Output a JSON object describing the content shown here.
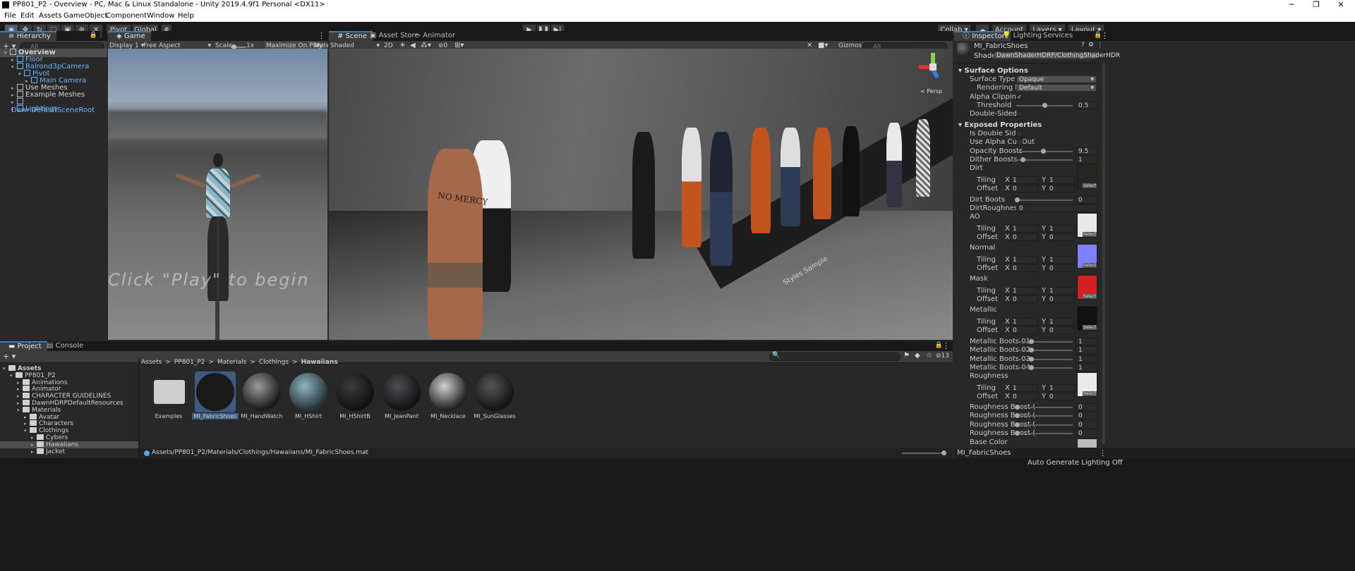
{
  "window": {
    "title": "PP801_P2 - Overview - PC, Mac & Linux Standalone - Unity 2019.4.9f1 Personal <DX11>",
    "controls": [
      "─",
      "❐",
      "✕"
    ]
  },
  "menu": [
    "File",
    "Edit",
    "Assets",
    "GameObject",
    "Component",
    "Window",
    "Help"
  ],
  "toolbar": {
    "pivot": "Pivot",
    "global": "Global",
    "collab": "Collab ▾",
    "account": "Account",
    "layers": "Layers",
    "layout": "Layout"
  },
  "hierarchy": {
    "tab": "Hierarchy",
    "search_placeholder": "All",
    "items": [
      {
        "label": "Overview",
        "indent": 0,
        "selected": true,
        "blue": false
      },
      {
        "label": "Floor",
        "indent": 1,
        "blue": true
      },
      {
        "label": "Balrond3pCamera",
        "indent": 1,
        "blue": true
      },
      {
        "label": "Pivot",
        "indent": 2,
        "blue": true
      },
      {
        "label": "Main Camera",
        "indent": 3,
        "blue": true
      },
      {
        "label": "Use Meshes",
        "indent": 1,
        "blue": false
      },
      {
        "label": "Example Meshes",
        "indent": 1,
        "blue": false
      },
      {
        "label": "DawnDefaultSceneRoot",
        "indent": 1,
        "blue": true
      },
      {
        "label": "Lightings",
        "indent": 1,
        "blue": true
      }
    ]
  },
  "game": {
    "tab": "Game",
    "display": "Display 1",
    "aspect": "Free Aspect",
    "scale_label": "Scale",
    "scale_value": "1x",
    "maximize": "Maximize On Play",
    "mute": "Mute",
    "overlay_text": "Click \"Play\" to begin"
  },
  "scene": {
    "tabs": [
      "Scene",
      "Asset Store",
      "Animator"
    ],
    "shading": "Shaded",
    "mode2d": "2D",
    "gizmos": "Gizmos",
    "search_placeholder": "All",
    "hidden_count": "0",
    "persp": "< Persp",
    "chest_text": "NO MERCY",
    "floor_text": "Styles Sample"
  },
  "inspector": {
    "tabs": [
      "Inspector",
      "Lighting",
      "Services"
    ],
    "material_name": "MI_FabricShoes",
    "shader_label": "Shader",
    "shader_value": "DawnShaderHDRP/ClothingShaderHDR",
    "surface_options": "Surface Options",
    "surface_type_label": "Surface Type",
    "surface_type": "Opaque",
    "rendering_pass_label": "Rendering Pass",
    "rendering_pass": "Default",
    "alpha_clipping": "Alpha Clipping",
    "threshold_label": "Threshold",
    "threshold": "0.5",
    "double_sided": "Double-Sided",
    "exposed": "Exposed Properties",
    "is_double_side": "Is Double Side",
    "use_alpha_cut": "Use Alpha Cut Out",
    "opacity_label": "Opacity Boosts",
    "opacity": "9.5",
    "dither_label": "Dither Boosts",
    "dither": "1",
    "tex_sections": [
      {
        "name": "Dirt",
        "color": "#2a2520"
      },
      {
        "name": "AO",
        "color": "#e9e9e9"
      },
      {
        "name": "Normal",
        "color": "#7f7fff"
      },
      {
        "name": "Mask",
        "color": "#d42020"
      },
      {
        "name": "Metallic",
        "color": "#111111"
      }
    ],
    "tiling": "Tiling",
    "offset": "Offset",
    "x": "X",
    "y": "Y",
    "one": "1",
    "zero": "0",
    "select": "Select",
    "dirt_boots_label": "Dirt Boots",
    "dirt_boots": "0",
    "dirt_roughness_label": "DirtRoughness_Po",
    "dirt_roughness": "0",
    "metallic_boosts": [
      {
        "label": "Metallic Boots 01",
        "value": "1"
      },
      {
        "label": "Metallic Boots 02",
        "value": "1"
      },
      {
        "label": "Metallic Boots 03",
        "value": "1"
      },
      {
        "label": "Metallic Boots 04",
        "value": "1"
      }
    ],
    "roughness_label": "Roughness",
    "roughness_boosts": [
      {
        "label": "Roughness Boost (",
        "value": "0"
      },
      {
        "label": "Roughness Boost (",
        "value": "0"
      },
      {
        "label": "Roughness Boost (",
        "value": "0"
      },
      {
        "label": "Roughness Boost (",
        "value": "0"
      }
    ],
    "base_color": "Base Color",
    "footer_name": "MI_FabricShoes"
  },
  "project": {
    "tabs": [
      "Project",
      "Console"
    ],
    "tree": [
      {
        "label": "Assets",
        "indent": 0,
        "bold": true
      },
      {
        "label": "PP801_P2",
        "indent": 1
      },
      {
        "label": "Animations",
        "indent": 2
      },
      {
        "label": "Animator",
        "indent": 2
      },
      {
        "label": "CHARACTER GUIDELINES",
        "indent": 2
      },
      {
        "label": "DawnHDRPDefaultResources",
        "indent": 2
      },
      {
        "label": "Materials",
        "indent": 2
      },
      {
        "label": "Avatar",
        "indent": 3
      },
      {
        "label": "Characters",
        "indent": 3
      },
      {
        "label": "Clothings",
        "indent": 3
      },
      {
        "label": "Cybers",
        "indent": 4
      },
      {
        "label": "Hawaiians",
        "indent": 4,
        "selected": true
      },
      {
        "label": "Jacket",
        "indent": 4
      }
    ],
    "breadcrumb": [
      "Assets",
      "PP801_P2",
      "Materials",
      "Clothings",
      "Hawaiians"
    ],
    "breadcrumb_sep": ">",
    "assets": [
      {
        "label": "Examples",
        "kind": "folder"
      },
      {
        "label": "MI_FabricShoes",
        "kind": "ball",
        "selected": true
      },
      {
        "label": "MI_HandWatch",
        "kind": "ball"
      },
      {
        "label": "MI_HShirt",
        "kind": "ball"
      },
      {
        "label": "MI_HShirtB",
        "kind": "ball"
      },
      {
        "label": "MI_JeanPant",
        "kind": "ball"
      },
      {
        "label": "MI_Necklace",
        "kind": "ball"
      },
      {
        "label": "MI_SunGlasses",
        "kind": "ball"
      }
    ],
    "path": "Assets/PP801_P2/Materials/Clothings/Hawaiians/MI_FabricShoes.mat",
    "count": "13"
  },
  "status": "Auto Generate Lighting Off"
}
